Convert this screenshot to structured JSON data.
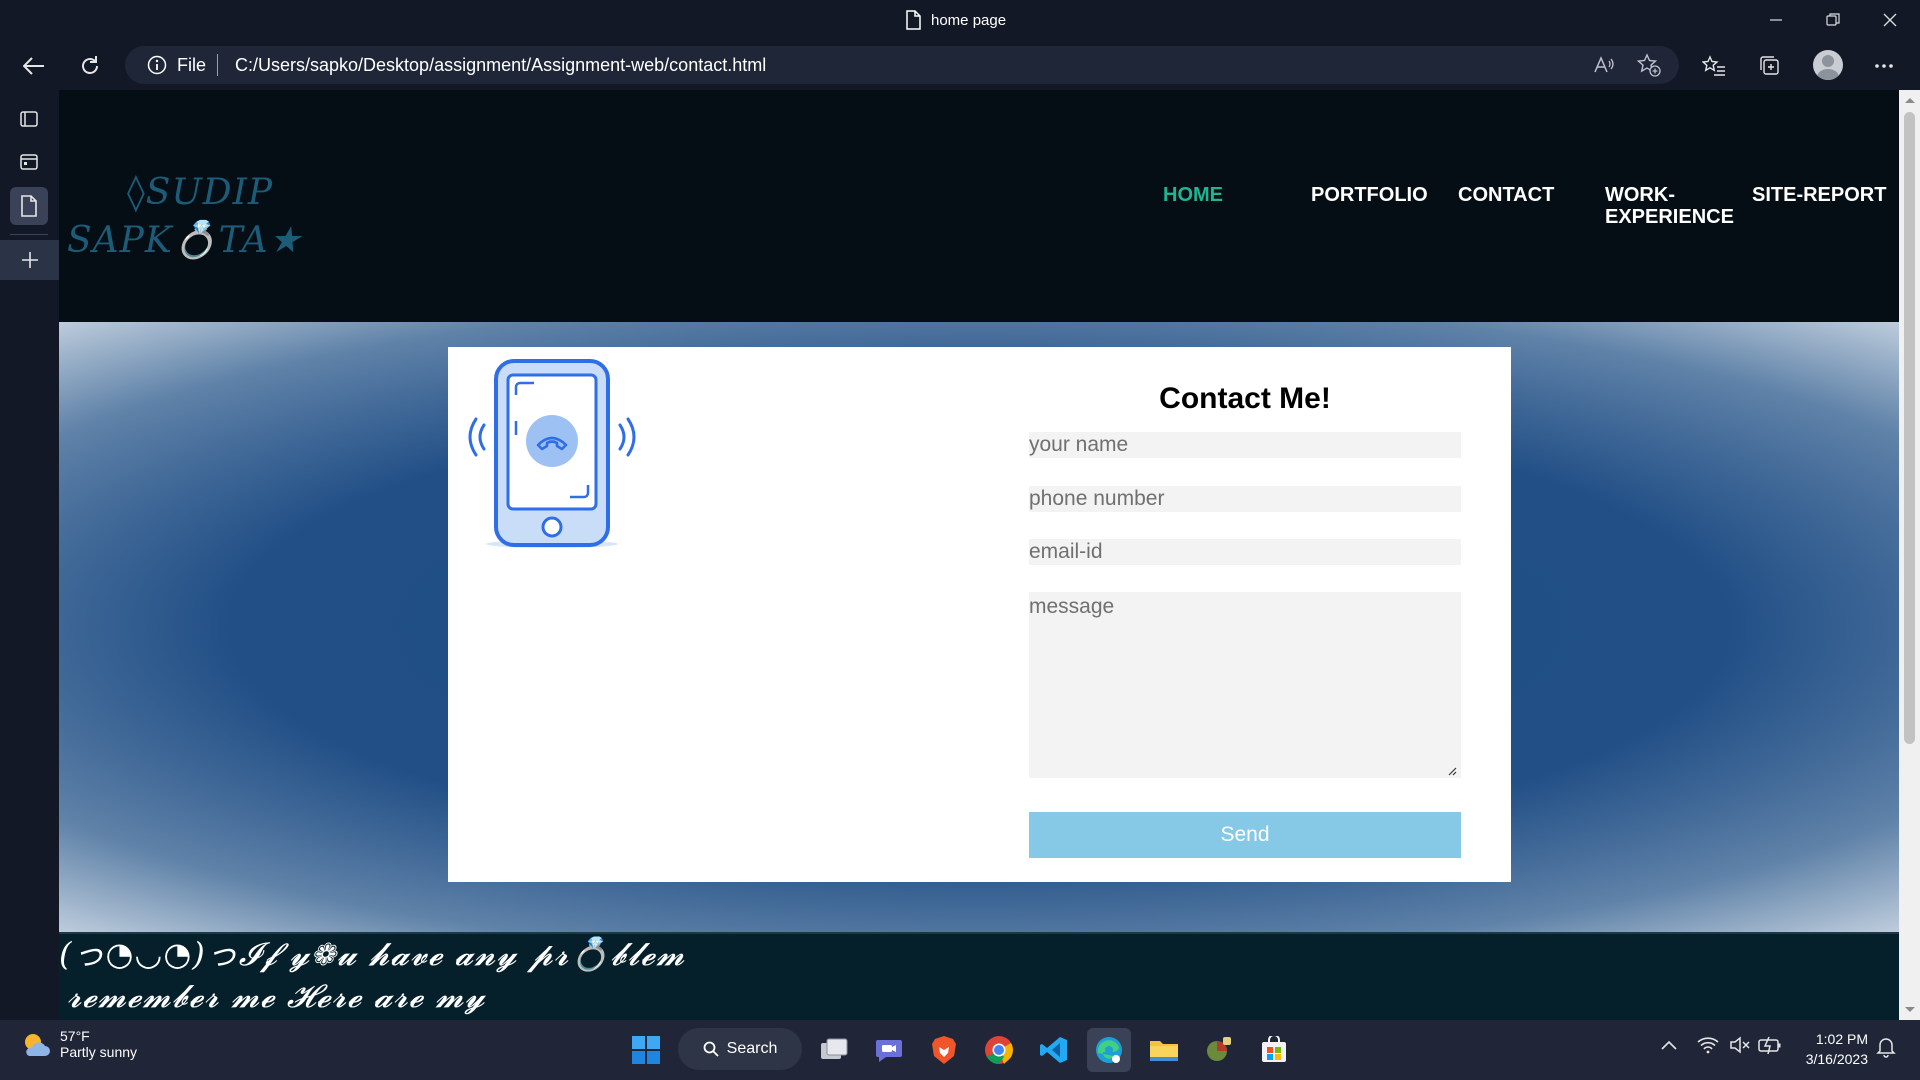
{
  "window": {
    "title": "home page"
  },
  "address": {
    "scheme_label": "File",
    "url": "C:/Users/sapko/Desktop/assignment/Assignment-web/contact.html"
  },
  "site": {
    "logo": {
      "line1": "◊SUDIP",
      "line2": "SAPK💍TA★"
    },
    "nav": [
      "HOME",
      "PORTFOLIO",
      "CONTACT",
      "WORK-",
      "EXPERIENCE",
      "SITE-REPORT"
    ],
    "accent_color": "#1fb593",
    "header_bg": "#050e14"
  },
  "contact_form": {
    "title": "Contact Me!",
    "name_placeholder": "your name",
    "phone_placeholder": "phone number",
    "email_placeholder": "email-id",
    "message_placeholder": "message",
    "send_label": "Send",
    "send_color": "#86c9e6"
  },
  "footer": {
    "line1": "(っ◔◡◔)っ𝓘𝓯 𝔂❁𝓾 𝓱𝓪𝓿𝓮 𝓪𝓷𝔂 𝓹𝓻💍𝓫𝓵𝓮𝓶",
    "line2": "𝓻𝓮𝓶𝓮𝓶𝓫𝓮𝓻 𝓶𝓮 𝓗𝓮𝓻𝓮 𝓪𝓻𝓮 𝓶𝔂"
  },
  "taskbar": {
    "weather_temp": "57°F",
    "weather_desc": "Partly sunny",
    "search_label": "Search",
    "time": "1:02 PM",
    "date": "3/16/2023"
  }
}
